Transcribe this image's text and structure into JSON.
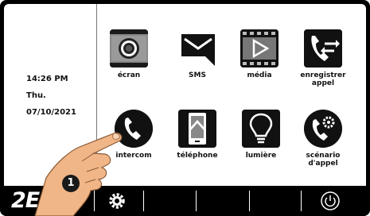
{
  "clock": {
    "time": "14:26 PM",
    "day": "Thu.",
    "date": "07/10/2021"
  },
  "apps": {
    "screen": {
      "label": "écran",
      "icon": "camera-icon"
    },
    "sms": {
      "label": "SMS",
      "icon": "message-icon"
    },
    "media": {
      "label": "média",
      "icon": "video-play-icon"
    },
    "record_call": {
      "label1": "enregistrer",
      "label2": "appel",
      "icon": "phone-transfer-icon"
    },
    "intercom": {
      "label": "intercom",
      "icon": "phone-icon"
    },
    "phone": {
      "label": "téléphone",
      "icon": "smartphone-icon"
    },
    "light": {
      "label": "lumière",
      "icon": "lightbulb-icon"
    },
    "call_scenario": {
      "label1": "scénario",
      "label2": "d'appel",
      "icon": "phone-settings-icon"
    }
  },
  "bottombar": {
    "logo": "2EAS",
    "settings_icon": "gear-icon",
    "power_icon": "power-icon"
  },
  "annotation": {
    "step": "1"
  }
}
